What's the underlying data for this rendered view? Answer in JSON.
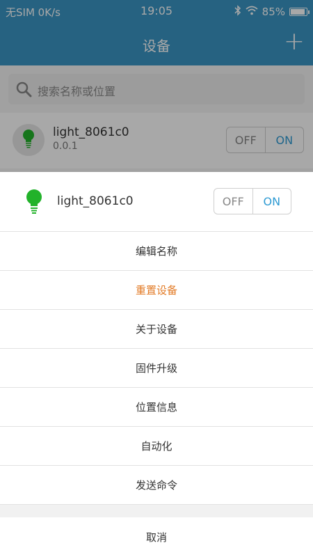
{
  "status_bar": {
    "carrier": "无SIM",
    "speed": "0K/s",
    "time": "19:05",
    "battery": "85%"
  },
  "nav": {
    "title": "设备",
    "add_label": "+"
  },
  "search": {
    "placeholder": "搜索名称或位置"
  },
  "device": {
    "name": "light_8061c0",
    "version": "0.0.1",
    "toggle": {
      "off_label": "OFF",
      "on_label": "ON"
    }
  },
  "sheet": {
    "device_name": "light_8061c0",
    "toggle": {
      "off_label": "OFF",
      "on_label": "ON"
    },
    "items": [
      {
        "label": "编辑名称"
      },
      {
        "label": "重置设备"
      },
      {
        "label": "关于设备"
      },
      {
        "label": "固件升级"
      },
      {
        "label": "位置信息"
      },
      {
        "label": "自动化"
      },
      {
        "label": "发送命令"
      }
    ],
    "cancel_label": "取消"
  },
  "colors": {
    "header": "#3a95c4",
    "bulb": "#22b22a",
    "on_text": "#2f9bd3",
    "danger_text": "#e27a25"
  }
}
